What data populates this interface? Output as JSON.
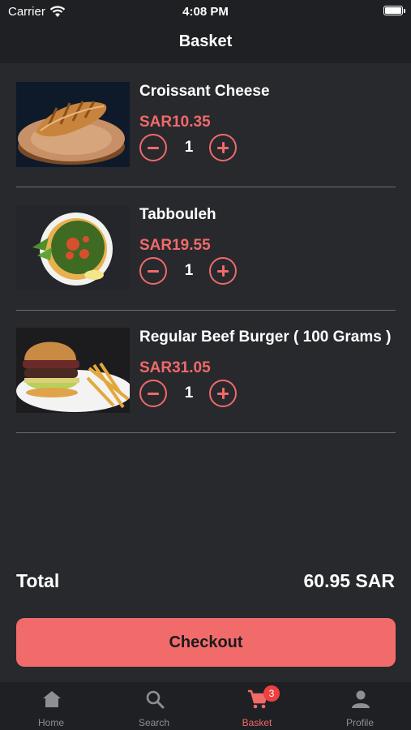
{
  "status_bar": {
    "carrier": "Carrier",
    "time": "4:08 PM"
  },
  "nav": {
    "title": "Basket"
  },
  "items": [
    {
      "name": "Croissant Cheese",
      "price": "SAR10.35",
      "quantity": "1"
    },
    {
      "name": "Tabbouleh",
      "price": "SAR19.55",
      "quantity": "1"
    },
    {
      "name": "Regular Beef Burger ( 100 Grams )",
      "price": "SAR31.05",
      "quantity": "1"
    }
  ],
  "summary": {
    "total_label": "Total",
    "total_value": "60.95 SAR"
  },
  "checkout_label": "Checkout",
  "tabs": [
    {
      "label": "Home",
      "icon": "home-icon"
    },
    {
      "label": "Search",
      "icon": "search-icon"
    },
    {
      "label": "Basket",
      "icon": "cart-icon",
      "badge": "3",
      "active": true
    },
    {
      "label": "Profile",
      "icon": "profile-icon"
    }
  ],
  "colors": {
    "accent": "#f06a6a",
    "background": "#28292d",
    "bar": "#1f2023",
    "badge": "#ef4040"
  }
}
